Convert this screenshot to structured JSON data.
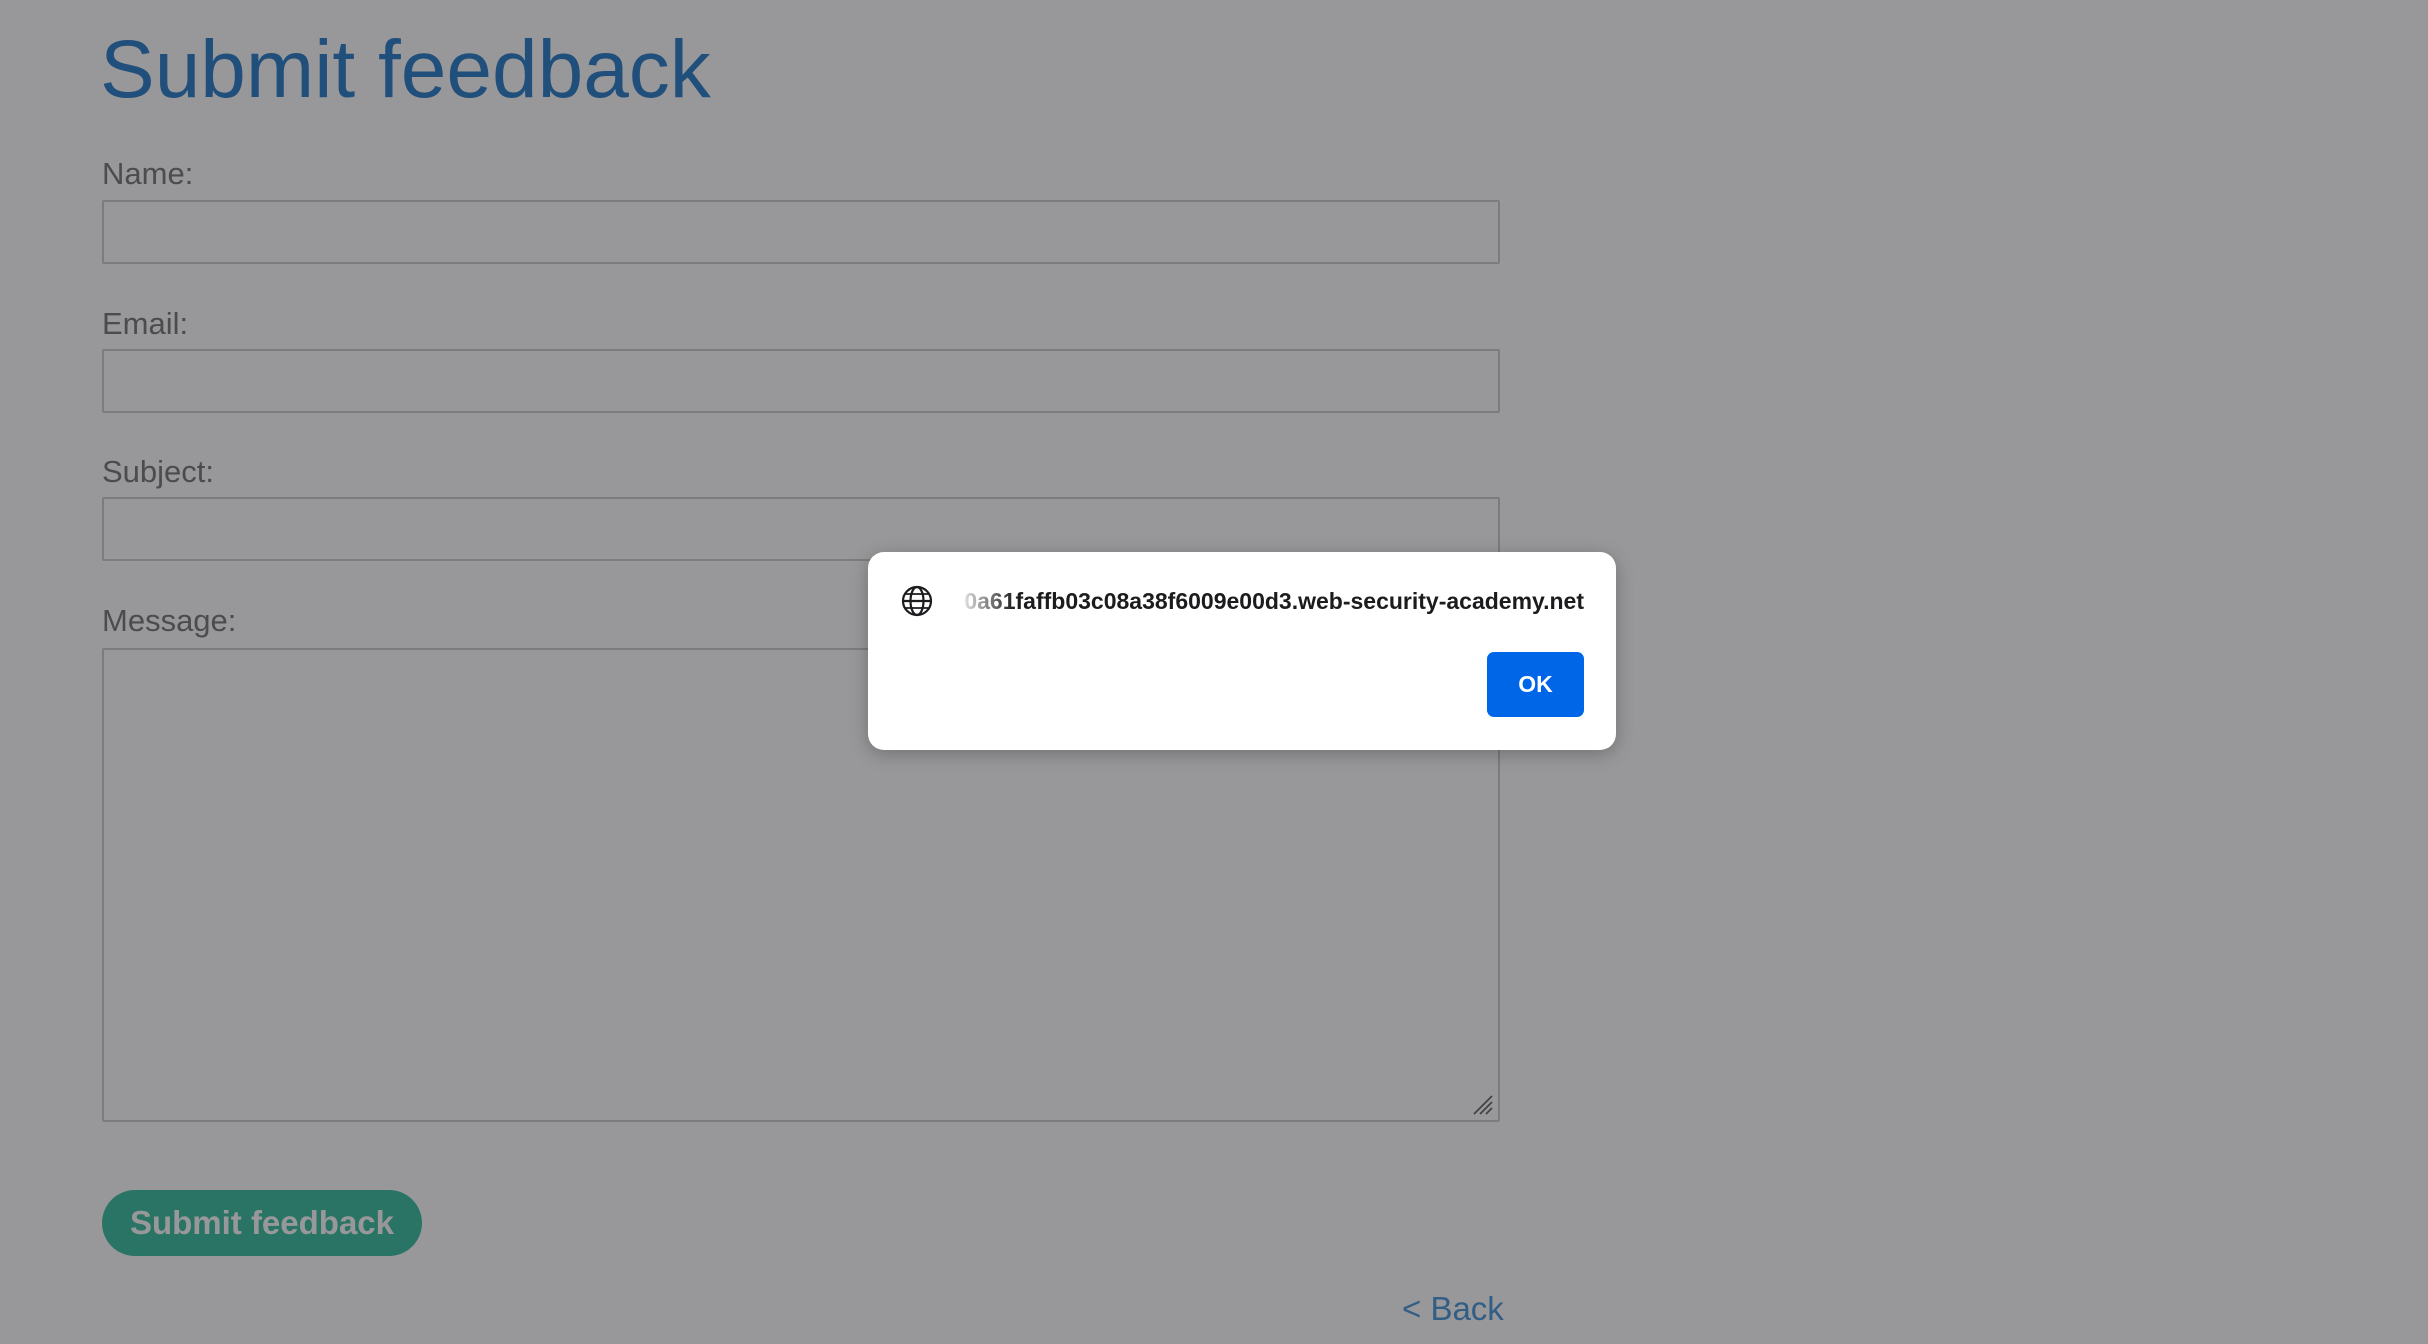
{
  "page": {
    "title": "Submit feedback",
    "colors": {
      "title": "#1a73c4",
      "submit_button": "#2bbb9a",
      "back_link": "#3d8fd6",
      "ok_button": "#0066e8"
    }
  },
  "form": {
    "fields": [
      {
        "label": "Name:",
        "value": ""
      },
      {
        "label": "Email:",
        "value": ""
      },
      {
        "label": "Subject:",
        "value": ""
      }
    ],
    "message": {
      "label": "Message:",
      "value": ""
    },
    "submit_label": "Submit feedback",
    "back_label": "< Back"
  },
  "dialog": {
    "icon": "globe-icon",
    "origin": "0a61faffb03c08a38f6009e00d3.web-security-academy.net",
    "ok_label": "OK"
  }
}
